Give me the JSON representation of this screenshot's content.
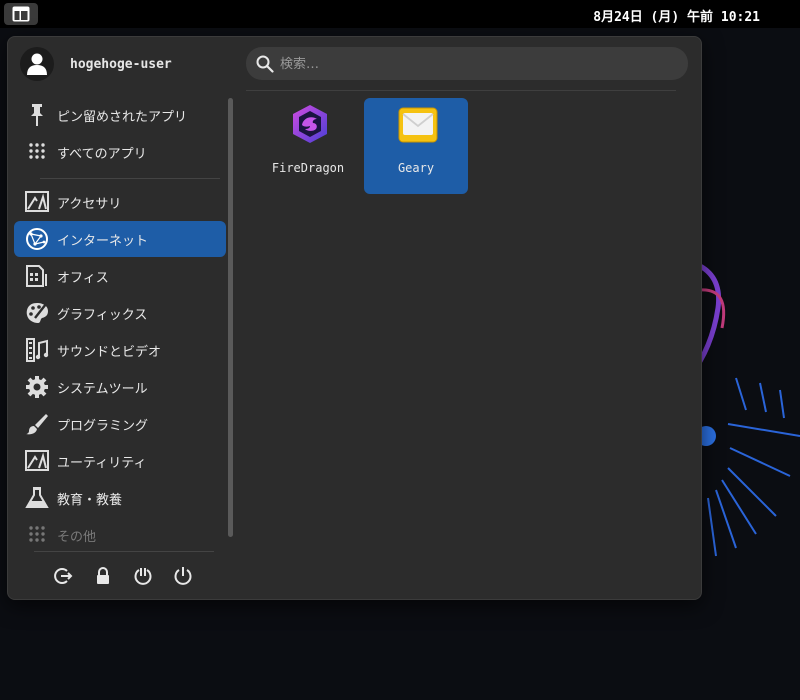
{
  "panel": {
    "clock": "8月24日 (月) 午前 10:21"
  },
  "menu": {
    "user": {
      "name": "hogehoge-user"
    },
    "search": {
      "placeholder": "検索…",
      "value": ""
    },
    "sidebar": {
      "favorites": [
        {
          "label": "ピン留めされたアプリ",
          "icon": "pin-icon"
        },
        {
          "label": "すべてのアプリ",
          "icon": "grid-icon"
        }
      ],
      "categories": [
        {
          "label": "アクセサリ",
          "icon": "accessories-icon",
          "selected": false
        },
        {
          "label": "インターネット",
          "icon": "globe-icon",
          "selected": true
        },
        {
          "label": "オフィス",
          "icon": "office-icon",
          "selected": false
        },
        {
          "label": "グラフィックス",
          "icon": "palette-icon",
          "selected": false
        },
        {
          "label": "サウンドとビデオ",
          "icon": "film-music-icon",
          "selected": false
        },
        {
          "label": "システムツール",
          "icon": "gear-icon",
          "selected": false
        },
        {
          "label": "プログラミング",
          "icon": "brush-icon",
          "selected": false
        },
        {
          "label": "ユーティリティ",
          "icon": "utilities-icon",
          "selected": false
        },
        {
          "label": "教育・教養",
          "icon": "flask-icon",
          "selected": false
        },
        {
          "label": "その他",
          "icon": "grid-icon",
          "selected": false,
          "dimmed": true
        }
      ]
    },
    "actions": [
      "logout-icon",
      "lock-icon",
      "suspend-icon",
      "power-icon"
    ],
    "apps": [
      {
        "name": "FireDragon",
        "icon": "firedragon-icon",
        "selected": false
      },
      {
        "name": "Geary",
        "icon": "geary-mail-icon",
        "selected": true
      }
    ]
  },
  "colors": {
    "accent": "#1e5da7",
    "menu_bg": "#2c2c2c",
    "panel_bg": "#000000"
  }
}
